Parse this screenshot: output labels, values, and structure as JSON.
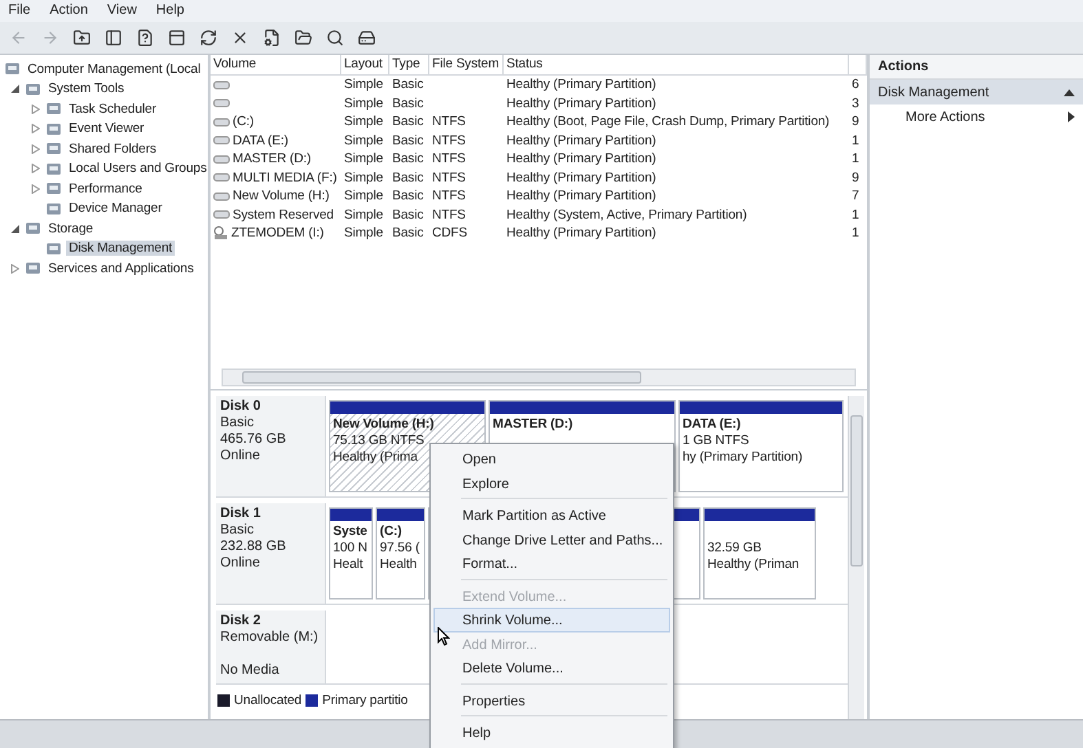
{
  "menu_bar": [
    "File",
    "Action",
    "View",
    "Help"
  ],
  "toolbar": [
    {
      "kind": "back",
      "disabled": true
    },
    {
      "kind": "forward",
      "disabled": true
    },
    {
      "kind": "up"
    },
    {
      "kind": "tree"
    },
    {
      "kind": "help"
    },
    {
      "kind": "panel"
    },
    {
      "kind": "refresh"
    },
    {
      "kind": "delete"
    },
    {
      "kind": "properties"
    },
    {
      "kind": "open"
    },
    {
      "kind": "search"
    },
    {
      "kind": "disk"
    }
  ],
  "tree": [
    {
      "label": "Computer Management (Local",
      "selected": false,
      "children": [
        {
          "label": "System Tools",
          "expanded": true,
          "selected": false,
          "children": [
            {
              "label": "Task Scheduler",
              "expanded": false,
              "selected": false
            },
            {
              "label": "Event Viewer",
              "expanded": false,
              "selected": false
            },
            {
              "label": "Shared Folders",
              "expanded": false,
              "selected": false
            },
            {
              "label": "Local Users and Groups",
              "expanded": false,
              "selected": false
            },
            {
              "label": "Performance",
              "expanded": false,
              "selected": false
            },
            {
              "label": "Device Manager",
              "selected": false
            }
          ]
        },
        {
          "label": "Storage",
          "expanded": true,
          "selected": false,
          "children": [
            {
              "label": "Disk Management",
              "selected": true
            }
          ]
        },
        {
          "label": "Services and Applications",
          "expanded": false,
          "selected": false
        }
      ]
    }
  ],
  "table": {
    "columns": [
      "Volume",
      "Layout",
      "Type",
      "File System",
      "Status"
    ],
    "rows": [
      {
        "kind": "disk",
        "layout": "Simple",
        "type": "Basic",
        "status": "Healthy (Primary Partition)",
        "column_6": "6"
      },
      {
        "kind": "disk",
        "layout": "Simple",
        "type": "Basic",
        "status": "Healthy (Primary Partition)",
        "column_6": "3"
      },
      {
        "kind": "disk",
        "volume": "(C:)",
        "layout": "Simple",
        "type": "Basic",
        "file_system": "NTFS",
        "status": "Healthy (Boot, Page File, Crash Dump, Primary Partition)",
        "column_6": "9"
      },
      {
        "kind": "disk",
        "volume": "DATA (E:)",
        "layout": "Simple",
        "type": "Basic",
        "file_system": "NTFS",
        "status": "Healthy (Primary Partition)",
        "column_6": "1"
      },
      {
        "kind": "disk",
        "volume": "MASTER (D:)",
        "layout": "Simple",
        "type": "Basic",
        "file_system": "NTFS",
        "status": "Healthy (Primary Partition)",
        "column_6": "1"
      },
      {
        "kind": "disk",
        "volume": "MULTI MEDIA (F:)",
        "layout": "Simple",
        "type": "Basic",
        "file_system": "NTFS",
        "status": "Healthy (Primary Partition)",
        "column_6": "9"
      },
      {
        "kind": "disk",
        "volume": "New Volume (H:)",
        "layout": "Simple",
        "type": "Basic",
        "file_system": "NTFS",
        "status": "Healthy (Primary Partition)",
        "column_6": "7"
      },
      {
        "kind": "disk",
        "volume": "System Reserved",
        "layout": "Simple",
        "type": "Basic",
        "file_system": "NTFS",
        "status": "Healthy (System, Active, Primary Partition)",
        "column_6": "1"
      },
      {
        "kind": "cd",
        "volume": "ZTEMODEM (I:)",
        "layout": "Simple",
        "type": "Basic",
        "file_system": "CDFS",
        "status": "Healthy (Primary Partition)",
        "column_6": "1"
      }
    ]
  },
  "disks": [
    {
      "name": "Disk 0",
      "lines": [
        "Basic",
        "465.76 GB",
        "Online"
      ],
      "partitions": [
        {
          "name": "New Volume  (H:)",
          "size": "75.13 GB NTFS",
          "status": "Healthy (Prima",
          "selected": true
        },
        {
          "name": "MASTER  (D:)",
          "selected": false
        },
        {
          "name": "DATA  (E:)",
          "size": "1 GB NTFS",
          "status": "hy (Primary Partition)",
          "selected": false
        }
      ]
    },
    {
      "name": "Disk 1",
      "lines": [
        "Basic",
        "232.88 GB",
        "Online"
      ],
      "partitions": [
        {
          "name": "Syste",
          "size": "100 N",
          "status": "Healt",
          "selected": false
        },
        {
          "name": "(C:)",
          "size": "97.56 (",
          "status": "Health",
          "selected": false
        },
        {
          "selected": false
        },
        {
          "size": "32.59 GB",
          "status": "Healthy (Priman",
          "selected": false
        }
      ]
    },
    {
      "name": "Disk 2",
      "lines": [
        "Removable (M:)",
        "No Media"
      ]
    }
  ],
  "legend": [
    {
      "label": "Unallocated",
      "color": "#1a1a2a"
    },
    {
      "label": "Primary partitio",
      "color": "#1c2a9c"
    }
  ],
  "actions": {
    "title": "Actions",
    "section": {
      "label": "Disk Management",
      "expanded": true
    },
    "items": [
      {
        "label": "More Actions"
      }
    ]
  },
  "context_menu": [
    {
      "kind": "item",
      "label": "Open",
      "disabled": false,
      "selected": false
    },
    {
      "kind": "item",
      "label": "Explore",
      "disabled": false,
      "selected": false
    },
    {
      "kind": "separator"
    },
    {
      "kind": "item",
      "label": "Mark Partition as Active",
      "disabled": false,
      "selected": false
    },
    {
      "kind": "item",
      "label": "Change Drive Letter and Paths...",
      "disabled": false,
      "selected": false
    },
    {
      "kind": "item",
      "label": "Format...",
      "disabled": false,
      "selected": false
    },
    {
      "kind": "separator"
    },
    {
      "kind": "item",
      "label": "Extend Volume...",
      "disabled": true,
      "selected": false
    },
    {
      "kind": "item",
      "label": "Shrink Volume...",
      "disabled": false,
      "selected": true
    },
    {
      "kind": "item",
      "label": "Add Mirror...",
      "disabled": true,
      "selected": false
    },
    {
      "kind": "item",
      "label": "Delete Volume...",
      "disabled": false,
      "selected": false
    },
    {
      "kind": "separator"
    },
    {
      "kind": "item",
      "label": "Properties",
      "disabled": false,
      "selected": false
    },
    {
      "kind": "separator"
    },
    {
      "kind": "item",
      "label": "Help",
      "disabled": false,
      "selected": false
    }
  ]
}
